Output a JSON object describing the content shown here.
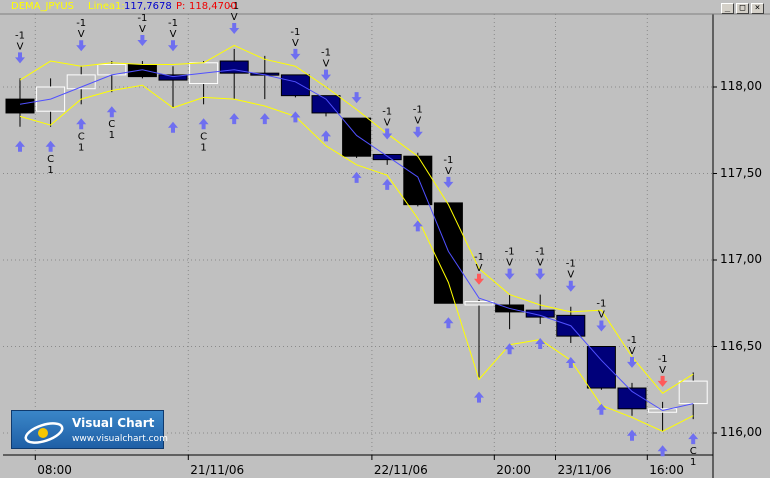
{
  "header": {
    "instrument": "DEMA_JPYUS",
    "series_label": "Linea1:",
    "series_value": "117,7678",
    "p_label": "P:",
    "p_value": "118,4700"
  },
  "window_buttons": {
    "minimize": "_",
    "maximize": "□",
    "close": "×"
  },
  "logo": {
    "title": "Visual Chart",
    "url": "www.visualchart.com"
  },
  "chart_data": {
    "type": "candlestick",
    "instrument": "DEMA_JPYUS",
    "ylim": [
      115.95,
      118.46
    ],
    "y_ticks": [
      {
        "value": 118.0,
        "label": "118,00"
      },
      {
        "value": 117.5,
        "label": "117,50"
      },
      {
        "value": 117.0,
        "label": "117,00"
      },
      {
        "value": 116.5,
        "label": "116,50"
      },
      {
        "value": 116.0,
        "label": "116,00"
      }
    ],
    "x_ticks": [
      {
        "index": 0.5,
        "label": "08:00"
      },
      {
        "index": 5.5,
        "label": "21/11/06"
      },
      {
        "index": 11.5,
        "label": "22/11/06"
      },
      {
        "index": 15.5,
        "label": "20:00"
      },
      {
        "index": 17.5,
        "label": "23/11/06"
      },
      {
        "index": 20.5,
        "label": "16:00"
      }
    ],
    "candles": [
      {
        "o": 117.85,
        "h": 118.05,
        "l": 117.77,
        "c": 117.93,
        "color": "black"
      },
      {
        "o": 117.86,
        "h": 118.05,
        "l": 117.77,
        "c": 118.0,
        "color": "white"
      },
      {
        "o": 117.99,
        "h": 118.12,
        "l": 117.9,
        "c": 118.07,
        "color": "white"
      },
      {
        "o": 118.07,
        "h": 118.15,
        "l": 117.97,
        "c": 118.13,
        "color": "white"
      },
      {
        "o": 118.13,
        "h": 118.15,
        "l": 118.05,
        "c": 118.06,
        "color": "black"
      },
      {
        "o": 118.07,
        "h": 118.12,
        "l": 117.88,
        "c": 118.04,
        "color": "navy"
      },
      {
        "o": 118.02,
        "h": 118.15,
        "l": 117.9,
        "c": 118.14,
        "color": "white"
      },
      {
        "o": 118.15,
        "h": 118.22,
        "l": 117.93,
        "c": 118.08,
        "color": "navy"
      },
      {
        "o": 118.08,
        "h": 118.18,
        "l": 117.93,
        "c": 118.07,
        "color": "navy"
      },
      {
        "o": 118.07,
        "h": 118.07,
        "l": 117.94,
        "c": 117.95,
        "color": "navy"
      },
      {
        "o": 117.95,
        "h": 117.95,
        "l": 117.83,
        "c": 117.85,
        "color": "navy"
      },
      {
        "o": 117.82,
        "h": 117.82,
        "l": 117.59,
        "c": 117.6,
        "color": "black"
      },
      {
        "o": 117.61,
        "h": 117.61,
        "l": 117.55,
        "c": 117.58,
        "color": "navy"
      },
      {
        "o": 117.6,
        "h": 117.62,
        "l": 117.31,
        "c": 117.32,
        "color": "black"
      },
      {
        "o": 117.33,
        "h": 117.33,
        "l": 116.75,
        "c": 116.75,
        "color": "black"
      },
      {
        "o": 116.76,
        "h": 116.77,
        "l": 116.32,
        "c": 116.74,
        "color": "white"
      },
      {
        "o": 116.74,
        "h": 116.8,
        "l": 116.6,
        "c": 116.7,
        "color": "black"
      },
      {
        "o": 116.71,
        "h": 116.8,
        "l": 116.63,
        "c": 116.67,
        "color": "navy"
      },
      {
        "o": 116.68,
        "h": 116.73,
        "l": 116.52,
        "c": 116.56,
        "color": "navy"
      },
      {
        "o": 116.5,
        "h": 116.5,
        "l": 116.25,
        "c": 116.26,
        "color": "navy"
      },
      {
        "o": 116.26,
        "h": 116.29,
        "l": 116.1,
        "c": 116.14,
        "color": "navy"
      },
      {
        "o": 116.14,
        "h": 116.18,
        "l": 116.01,
        "c": 116.12,
        "color": "white"
      },
      {
        "o": 116.17,
        "h": 116.35,
        "l": 116.08,
        "c": 116.3,
        "color": "white"
      }
    ],
    "series": [
      {
        "name": "Linea1",
        "color": "#5050ff",
        "values": [
          117.9,
          117.93,
          118.0,
          118.07,
          118.1,
          118.06,
          118.08,
          118.1,
          118.07,
          118.03,
          117.93,
          117.72,
          117.6,
          117.48,
          117.05,
          116.78,
          116.72,
          116.68,
          116.62,
          116.42,
          116.24,
          116.13,
          116.17
        ]
      },
      {
        "name": "upper band",
        "color": "#ffff00",
        "values": [
          118.04,
          118.15,
          118.12,
          118.14,
          118.13,
          118.13,
          118.14,
          118.24,
          118.16,
          118.12,
          118.0,
          117.87,
          117.73,
          117.6,
          117.32,
          116.95,
          116.8,
          116.74,
          116.7,
          116.71,
          116.44,
          116.23,
          116.34
        ]
      },
      {
        "name": "lower band",
        "color": "#ffff00",
        "values": [
          117.83,
          117.78,
          117.93,
          117.98,
          118.01,
          117.88,
          117.94,
          117.93,
          117.89,
          117.83,
          117.66,
          117.55,
          117.49,
          117.24,
          116.87,
          116.31,
          116.51,
          116.54,
          116.42,
          116.16,
          116.09,
          116.01,
          116.1
        ]
      }
    ],
    "signals_above": [
      {
        "index": 0,
        "text": [
          "-1",
          "V"
        ],
        "arrow": "blue"
      },
      {
        "index": 2,
        "text": [
          "-1",
          "V"
        ],
        "arrow": "blue"
      },
      {
        "index": 4,
        "text": [
          "-1",
          "V"
        ],
        "arrow": "blue"
      },
      {
        "index": 5,
        "text": [
          "-1",
          "V"
        ],
        "arrow": "blue"
      },
      {
        "index": 7,
        "text": [
          "-1",
          "V"
        ],
        "arrow": "blue"
      },
      {
        "index": 9,
        "text": [
          "-1",
          "V"
        ],
        "arrow": "blue"
      },
      {
        "index": 10,
        "text": [
          "-1",
          "V"
        ],
        "arrow": "blue"
      },
      {
        "index": 11,
        "text": [],
        "arrow": "blue"
      },
      {
        "index": 12,
        "text": [
          "-1",
          "V"
        ],
        "arrow": "blue"
      },
      {
        "index": 13,
        "text": [
          "-1",
          "V"
        ],
        "arrow": "blue"
      },
      {
        "index": 14,
        "text": [
          "-1",
          "V"
        ],
        "arrow": "blue"
      },
      {
        "index": 15,
        "text": [
          "-1",
          "V"
        ],
        "arrow": "red"
      },
      {
        "index": 16,
        "text": [
          "-1",
          "V"
        ],
        "arrow": "blue"
      },
      {
        "index": 17,
        "text": [
          "-1",
          "V"
        ],
        "arrow": "blue"
      },
      {
        "index": 18,
        "text": [
          "-1",
          "V"
        ],
        "arrow": "blue"
      },
      {
        "index": 19,
        "text": [
          "-1",
          "V"
        ],
        "arrow": "blue"
      },
      {
        "index": 20,
        "text": [
          "-1",
          "V"
        ],
        "arrow": "blue"
      },
      {
        "index": 21,
        "text": [
          "-1",
          "V"
        ],
        "arrow": "red"
      }
    ],
    "signals_below": [
      {
        "index": 0,
        "text": [],
        "arrow": "blue"
      },
      {
        "index": 1,
        "text": [
          "C",
          "1"
        ],
        "arrow": "blue"
      },
      {
        "index": 2,
        "text": [
          "C",
          "1"
        ],
        "arrow": "blue"
      },
      {
        "index": 3,
        "text": [
          "C",
          "1"
        ],
        "arrow": "blue"
      },
      {
        "index": 5,
        "text": [],
        "arrow": "blue"
      },
      {
        "index": 6,
        "text": [
          "C",
          "1"
        ],
        "arrow": "blue"
      },
      {
        "index": 7,
        "text": [],
        "arrow": "blue"
      },
      {
        "index": 8,
        "text": [],
        "arrow": "blue"
      },
      {
        "index": 9,
        "text": [],
        "arrow": "blue"
      },
      {
        "index": 10,
        "text": [],
        "arrow": "blue"
      },
      {
        "index": 11,
        "text": [],
        "arrow": "blue"
      },
      {
        "index": 12,
        "text": [],
        "arrow": "blue"
      },
      {
        "index": 13,
        "text": [],
        "arrow": "blue"
      },
      {
        "index": 14,
        "text": [],
        "arrow": "blue"
      },
      {
        "index": 15,
        "text": [],
        "arrow": "blue"
      },
      {
        "index": 16,
        "text": [],
        "arrow": "blue"
      },
      {
        "index": 17,
        "text": [],
        "arrow": "blue"
      },
      {
        "index": 18,
        "text": [],
        "arrow": "blue"
      },
      {
        "index": 19,
        "text": [],
        "arrow": "blue"
      },
      {
        "index": 20,
        "text": [],
        "arrow": "blue"
      },
      {
        "index": 21,
        "text": [],
        "arrow": "blue"
      },
      {
        "index": 22,
        "text": [
          "C",
          "1"
        ],
        "arrow": "blue"
      }
    ]
  }
}
